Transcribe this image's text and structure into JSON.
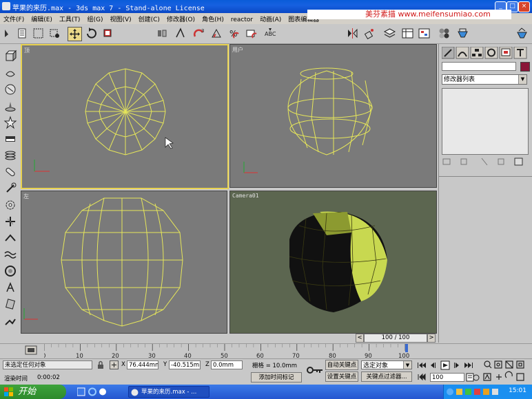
{
  "window": {
    "title": "苹果的来历.max  - 3ds max 7  - Stand-alone License",
    "watermark": "美芬素描 www.meifensumiao.com"
  },
  "menu": [
    "文件(F)",
    "编辑(E)",
    "工具(T)",
    "组(G)",
    "视图(V)",
    "创建(C)",
    "修改器(O)",
    "角色(H)",
    "reactor",
    "动画(A)",
    "图表编辑器"
  ],
  "toolbar": {
    "view_dropdown": "视图",
    "selection_set": "",
    "view_dropdown2": "视图"
  },
  "viewports": {
    "top": "顶",
    "user": "用户",
    "left": "左",
    "camera": "Camera01"
  },
  "right_panel": {
    "object_name": "",
    "modifier_list": "修改器列表"
  },
  "timeline": {
    "frame_display": "100 / 100",
    "ticks": [
      "0",
      "10",
      "20",
      "30",
      "40",
      "50",
      "60",
      "70",
      "80",
      "90",
      "100"
    ]
  },
  "status": {
    "selection": "未选定任何对象",
    "render_time_label": "渲染时间",
    "render_time": "0:00:02",
    "x_label": "X",
    "x_value": "76.444mm",
    "y_label": "Y",
    "y_value": "-40.515mm",
    "z_label": "Z",
    "z_value": "0.0mm",
    "grid": "栅格 = 10.0mm",
    "add_time_tag": "添加时间标记",
    "auto_key": "自动关键点",
    "set_key": "设置关键点",
    "selected_object": "选定对象",
    "key_filters": "关键点过滤器...",
    "frame_field": "100"
  },
  "taskbar": {
    "start": "开始",
    "task": "苹果的来历.max - ...",
    "clock": "15:01"
  },
  "colors": {
    "title_blue": "#0b48c4",
    "active_viewport": "#e8d250",
    "wireframe": "#e6e65a",
    "camera_bg": "#5c6650",
    "apple_shade": "#c8d850"
  }
}
